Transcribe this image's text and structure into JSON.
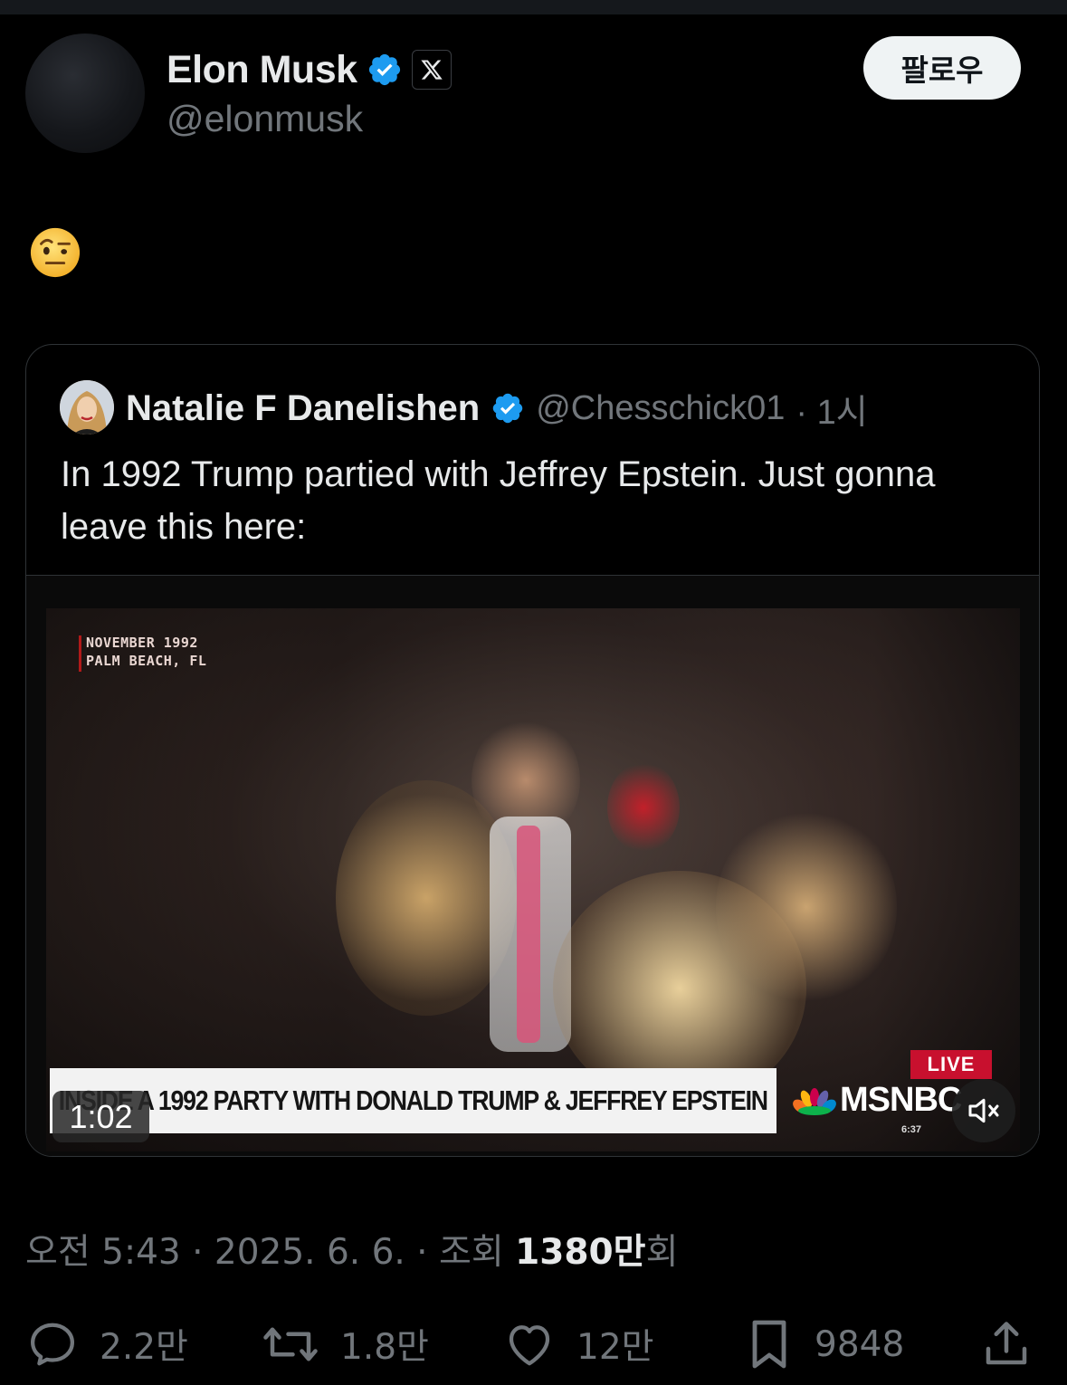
{
  "author": {
    "name": "Elon Musk",
    "handle": "@elonmusk",
    "follow_label": "팔로우"
  },
  "tweet": {
    "emoji": "face-with-raised-eyebrow",
    "timestamp": "오전 5:43 · 2025. 6. 6. · 조회 ",
    "views": "1380만",
    "views_suffix": "회"
  },
  "quoted": {
    "name": "Natalie F Danelishen",
    "handle": "@Chesschick01",
    "time": "· 1시",
    "text": "In 1992 Trump partied with Jeffrey Epstein. Just gonna leave this here:",
    "video": {
      "dateline_1": "NOVEMBER 1992",
      "dateline_2": "PALM BEACH, FL",
      "chyron": "INSIDE A 1992 PARTY WITH DONALD TRUMP & JEFFREY EPSTEIN",
      "live_label": "LIVE",
      "network": "MSNBC",
      "clock": "6:37",
      "duration": "1:02"
    }
  },
  "actions": {
    "replies": "2.2만",
    "reposts": "1.8만",
    "likes": "12만",
    "bookmarks": "9848"
  },
  "colors": {
    "background": "#000000",
    "text_primary": "#e7e9ea",
    "text_secondary": "#71767b",
    "verified": "#1d9bf0",
    "border": "#2f3336",
    "live_red": "#c8102e"
  }
}
